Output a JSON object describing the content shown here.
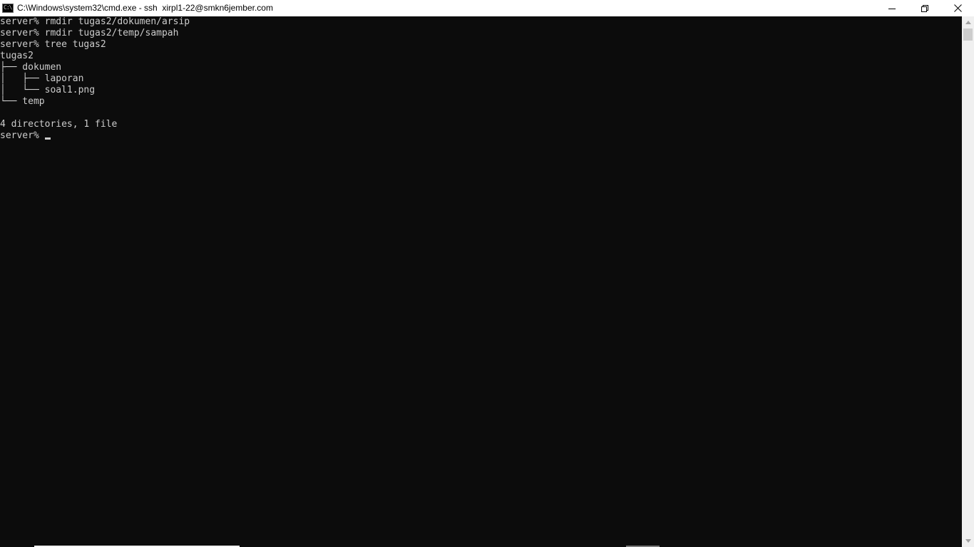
{
  "window": {
    "title": "C:\\Windows\\system32\\cmd.exe - ssh  xirpl1-22@smkn6jember.com",
    "icon": "cmd-icon",
    "controls": {
      "minimize_icon": "minimize-icon",
      "restore_icon": "restore-icon",
      "close_icon": "close-icon"
    }
  },
  "console": {
    "lines": [
      "server% rmdir tugas2/dokumen/arsip",
      "server% rmdir tugas2/temp/sampah",
      "server% tree tugas2",
      "tugas2",
      "├── dokumen",
      "│   ├── laporan",
      "│   └── soal1.png",
      "└── temp",
      "",
      "4 directories, 1 file"
    ],
    "prompt": "server% "
  },
  "colors": {
    "console_bg": "#0c0c0c",
    "console_text": "#cccccc",
    "titlebar_bg": "#ffffff",
    "scrollbar_bg": "#f0f0f0",
    "scrollbar_thumb": "#cdcdcd"
  }
}
